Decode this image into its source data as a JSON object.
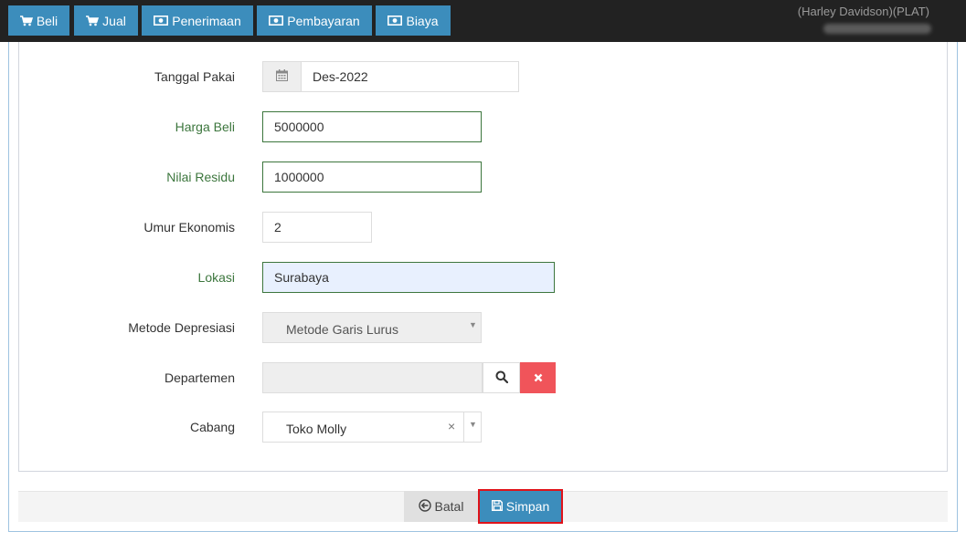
{
  "topnav": {
    "buttons": [
      {
        "label": "Beli",
        "icon": "cart-icon"
      },
      {
        "label": "Jual",
        "icon": "cart-icon"
      },
      {
        "label": "Penerimaan",
        "icon": "money-icon"
      },
      {
        "label": "Pembayaran",
        "icon": "money-icon"
      },
      {
        "label": "Biaya",
        "icon": "money-icon"
      }
    ],
    "user_label": "(Harley Davidson)(PLAT)"
  },
  "form": {
    "tanggal_pakai": {
      "label": "Tanggal Pakai",
      "value": "Des-2022"
    },
    "harga_beli": {
      "label": "Harga Beli",
      "value": "5000000"
    },
    "nilai_residu": {
      "label": "Nilai Residu",
      "value": "1000000"
    },
    "umur_ekonomis": {
      "label": "Umur Ekonomis",
      "value": "2"
    },
    "lokasi": {
      "label": "Lokasi",
      "value": "Surabaya"
    },
    "metode_depresiasi": {
      "label": "Metode Depresiasi",
      "value": "Metode Garis Lurus"
    },
    "departemen": {
      "label": "Departemen",
      "value": ""
    },
    "cabang": {
      "label": "Cabang",
      "value": "Toko Molly"
    }
  },
  "footer": {
    "cancel_label": "Batal",
    "save_label": "Simpan"
  },
  "colors": {
    "primary": "#3c8dbc",
    "topbar": "#222222",
    "success_text": "#3c763d",
    "danger": "#f0545a",
    "highlight": "#e0131a"
  }
}
